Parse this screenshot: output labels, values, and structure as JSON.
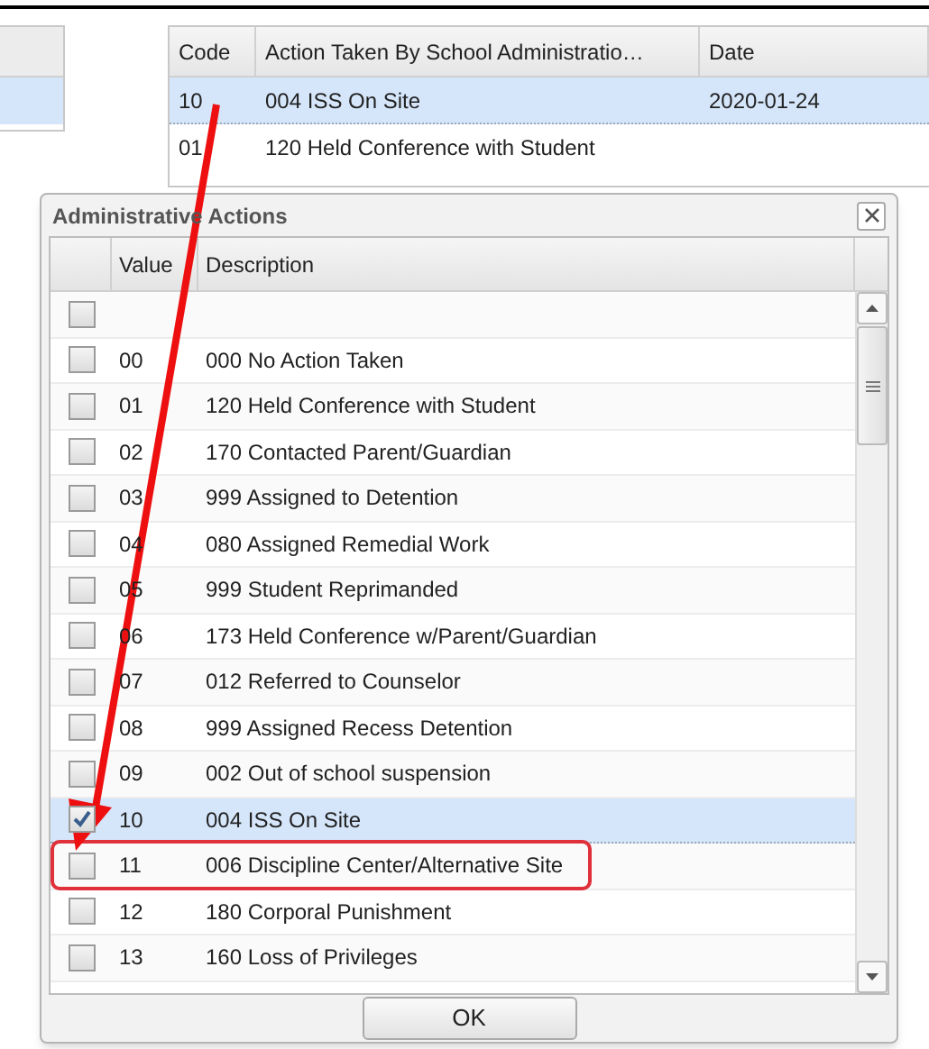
{
  "background_table": {
    "columns": [
      "Code",
      "Action Taken By School Administratio…",
      "Date"
    ],
    "rows": [
      {
        "code": "10",
        "action": "004 ISS On Site",
        "date": "2020-01-24",
        "selected": true
      },
      {
        "code": "01",
        "action": "120 Held Conference with Student",
        "date": "",
        "selected": false
      }
    ]
  },
  "dialog": {
    "title": "Administrative Actions",
    "columns": [
      "Value",
      "Description"
    ],
    "rows": [
      {
        "value": "",
        "description": "",
        "checked": false,
        "selected": false,
        "highlighted": false
      },
      {
        "value": "00",
        "description": "000 No Action Taken",
        "checked": false,
        "selected": false,
        "highlighted": false
      },
      {
        "value": "01",
        "description": "120 Held Conference with Student",
        "checked": false,
        "selected": false,
        "highlighted": false
      },
      {
        "value": "02",
        "description": "170 Contacted Parent/Guardian",
        "checked": false,
        "selected": false,
        "highlighted": false
      },
      {
        "value": "03",
        "description": "999 Assigned to Detention",
        "checked": false,
        "selected": false,
        "highlighted": false
      },
      {
        "value": "04",
        "description": "080 Assigned Remedial Work",
        "checked": false,
        "selected": false,
        "highlighted": false
      },
      {
        "value": "05",
        "description": "999 Student Reprimanded",
        "checked": false,
        "selected": false,
        "highlighted": false
      },
      {
        "value": "06",
        "description": "173 Held Conference w/Parent/Guardian",
        "checked": false,
        "selected": false,
        "highlighted": false
      },
      {
        "value": "07",
        "description": "012 Referred to Counselor",
        "checked": false,
        "selected": false,
        "highlighted": false
      },
      {
        "value": "08",
        "description": "999 Assigned Recess Detention",
        "checked": false,
        "selected": false,
        "highlighted": false
      },
      {
        "value": "09",
        "description": "002 Out of school suspension",
        "checked": false,
        "selected": false,
        "highlighted": false
      },
      {
        "value": "10",
        "description": "004 ISS On Site",
        "checked": true,
        "selected": true,
        "highlighted": false
      },
      {
        "value": "11",
        "description": "006 Discipline Center/Alternative Site",
        "checked": false,
        "selected": false,
        "highlighted": true
      },
      {
        "value": "12",
        "description": "180 Corporal Punishment",
        "checked": false,
        "selected": false,
        "highlighted": false
      },
      {
        "value": "13",
        "description": "160 Loss of Privileges",
        "checked": false,
        "selected": false,
        "highlighted": false
      }
    ],
    "ok_button": "OK"
  }
}
